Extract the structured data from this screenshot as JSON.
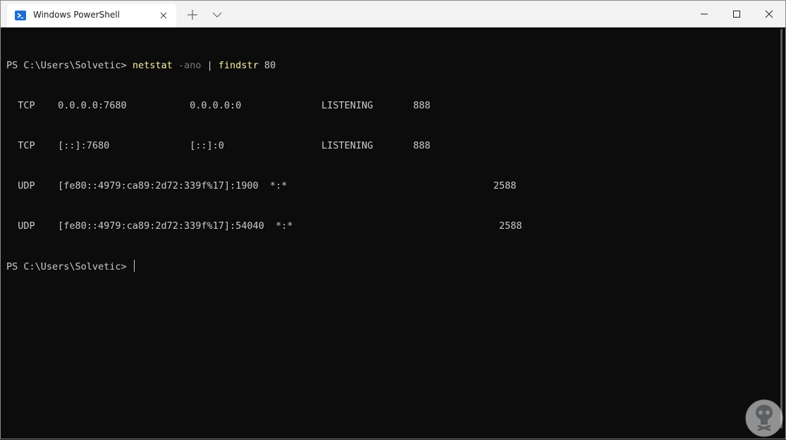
{
  "window": {
    "tab_title": "Windows PowerShell",
    "icons": {
      "tab_icon": "powershell-icon",
      "close": "close-icon",
      "new_tab": "plus-icon",
      "dropdown": "chevron-down-icon",
      "minimize": "minimize-icon",
      "maximize": "maximize-icon",
      "window_close": "close-icon"
    }
  },
  "terminal": {
    "prompt": "PS C:\\Users\\Solvetic> ",
    "command": {
      "name": "netstat",
      "param": "-ano",
      "pipe": "|",
      "filter": "findstr",
      "arg": "80"
    },
    "output": [
      "  TCP    0.0.0.0:7680           0.0.0.0:0              LISTENING       888",
      "  TCP    [::]:7680              [::]:0                 LISTENING       888",
      "  UDP    [fe80::4979:ca89:2d72:339f%17]:1900  *:*                                    2588",
      "  UDP    [fe80::4979:ca89:2d72:339f%17]:54040  *:*                                    2588"
    ],
    "final_prompt": "PS C:\\Users\\Solvetic> "
  },
  "colors": {
    "background": "#0c0c0c",
    "text": "#cccccc",
    "command": "#f9f1a5",
    "parameter": "#767676",
    "titlebar": "#f3f3f3"
  },
  "watermark_icon": "solvetic-logo"
}
